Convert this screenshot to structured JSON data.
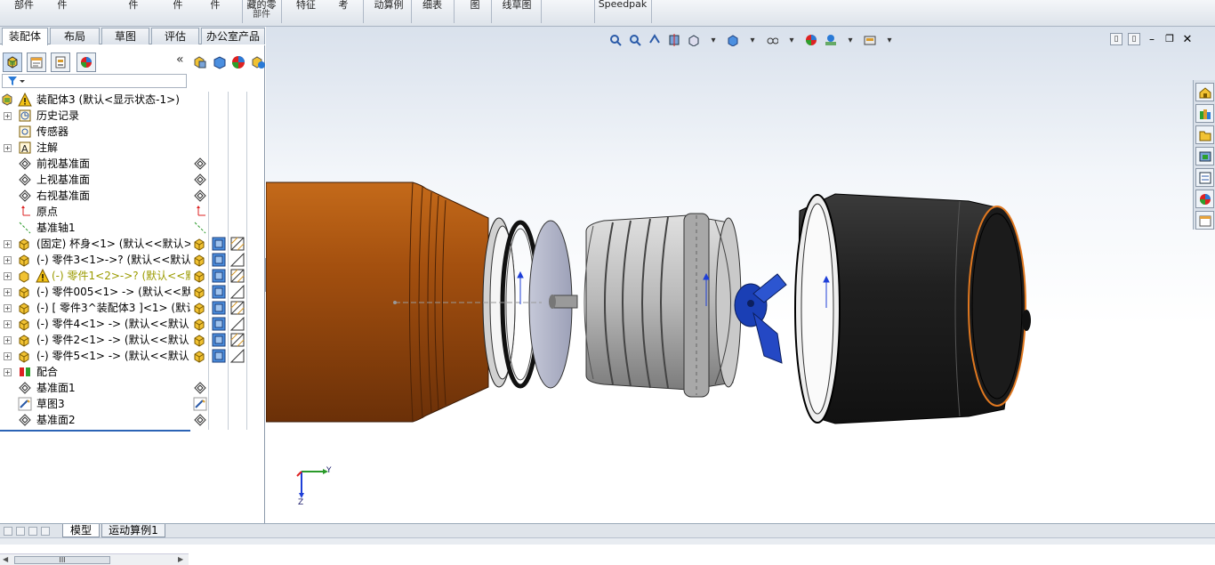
{
  "ribbon": {
    "items": [
      {
        "label": "部件",
        "sub": ""
      },
      {
        "label": "件",
        "sub": ""
      },
      {
        "label": "件",
        "sub": ""
      },
      {
        "label": "件",
        "sub": ""
      },
      {
        "label": "件",
        "sub": ""
      },
      {
        "label": "藏的零",
        "sub": "部件"
      },
      {
        "label": "特征",
        "sub": ""
      },
      {
        "label": "考",
        "sub": ""
      },
      {
        "label": "动算例",
        "sub": ""
      },
      {
        "label": "细表",
        "sub": ""
      },
      {
        "label": "图",
        "sub": ""
      },
      {
        "label": "线草图",
        "sub": ""
      },
      {
        "label": "Speedpak",
        "sub": ""
      }
    ]
  },
  "tabs": [
    "装配体",
    "布局",
    "草图",
    "评估",
    "办公室产品"
  ],
  "tree": [
    {
      "label": "装配体3  (默认<显示状态-1>)",
      "icon": "assembly-warning-icon",
      "expand": "-",
      "warn": false
    },
    {
      "label": "历史记录",
      "icon": "history-icon",
      "expand": "+",
      "warn": false
    },
    {
      "label": "传感器",
      "icon": "sensor-icon",
      "expand": "",
      "warn": false
    },
    {
      "label": "注解",
      "icon": "annotation-icon",
      "expand": "+",
      "warn": false
    },
    {
      "label": "前视基准面",
      "icon": "plane-icon",
      "expand": "",
      "warn": false
    },
    {
      "label": "上视基准面",
      "icon": "plane-icon",
      "expand": "",
      "warn": false
    },
    {
      "label": "右视基准面",
      "icon": "plane-icon",
      "expand": "",
      "warn": false
    },
    {
      "label": "原点",
      "icon": "origin-icon",
      "expand": "",
      "warn": false
    },
    {
      "label": "基准轴1",
      "icon": "axis-icon",
      "expand": "",
      "warn": false
    },
    {
      "label": "(固定) 杯身<1> (默认<<默认>",
      "icon": "part-icon",
      "expand": "+",
      "warn": false
    },
    {
      "label": "(-) 零件3<1>->? (默认<<默认>",
      "icon": "part-icon",
      "expand": "+",
      "warn": false
    },
    {
      "label": "(-) 零件1<2>->? (默认<<默认>",
      "icon": "part-warning-icon",
      "expand": "+",
      "warn": true
    },
    {
      "label": "(-) 零件005<1> -> (默认<<默认>",
      "icon": "part-icon",
      "expand": "+",
      "warn": false
    },
    {
      "label": "(-) [ 零件3^装配体3 ]<1> (默认",
      "icon": "part-icon",
      "expand": "+",
      "warn": false
    },
    {
      "label": "(-) 零件4<1> -> (默认<<默认>",
      "icon": "part-icon",
      "expand": "+",
      "warn": false
    },
    {
      "label": "(-) 零件2<1> -> (默认<<默认>",
      "icon": "part-icon",
      "expand": "+",
      "warn": false
    },
    {
      "label": "(-) 零件5<1> -> (默认<<默认>",
      "icon": "part-icon",
      "expand": "+",
      "warn": false
    },
    {
      "label": "配合",
      "icon": "mates-icon",
      "expand": "+",
      "warn": false
    },
    {
      "label": "基准面1",
      "icon": "plane-icon",
      "expand": "",
      "warn": false
    },
    {
      "label": "草图3",
      "icon": "sketch-icon",
      "expand": "",
      "warn": false
    },
    {
      "label": "基准面2",
      "icon": "plane-icon",
      "expand": "",
      "warn": false
    }
  ],
  "hscroll_label": "III",
  "bottom_tabs": [
    "模型",
    "运动算例1"
  ],
  "triad": {
    "y_label": "Y",
    "z_label": "Z"
  },
  "colors": {
    "cup_body": "#a4500f",
    "cap": "#1c1c1c",
    "knob": "#1a3fb5",
    "accent_orange": "#e07820"
  }
}
